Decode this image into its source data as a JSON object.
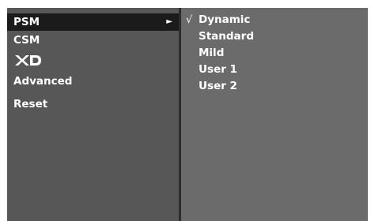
{
  "left_menu": {
    "items": [
      {
        "label": "PSM",
        "arrow": "►"
      },
      {
        "label": "CSM"
      },
      {
        "label": "XD",
        "logo": true
      },
      {
        "label": "Advanced"
      },
      {
        "label": "Reset"
      }
    ]
  },
  "submenu": {
    "check_mark": "√",
    "items": [
      "Dynamic",
      "Standard",
      "Mild",
      "User 1",
      "User 2"
    ],
    "selected": "Dynamic"
  },
  "colors": {
    "left_panel": "#575757",
    "right_panel": "#6b6b6b",
    "selected_row": "#1b1b1b",
    "text": "#ffffff"
  }
}
